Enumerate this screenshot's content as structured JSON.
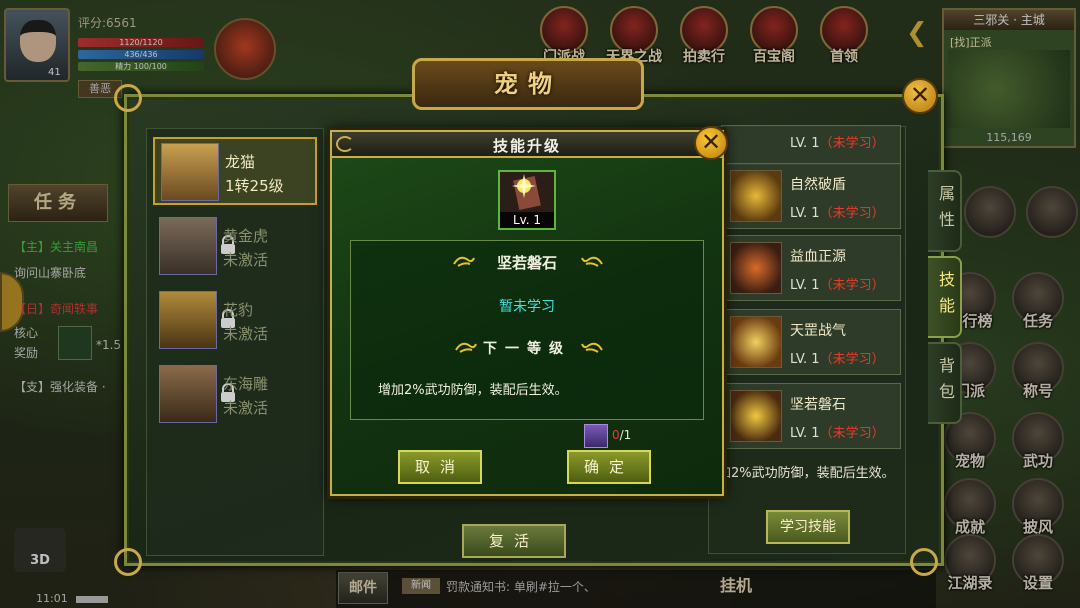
{
  "hud": {
    "score": "评分:6561",
    "hp": "1120/1120",
    "mp": "436/436",
    "stamina": "精力 100/100",
    "level": "41",
    "badge": "善恶"
  },
  "top_menu": [
    {
      "label": "门派战",
      "icon": "banner-icon"
    },
    {
      "label": "天界之战",
      "icon": "war-icon"
    },
    {
      "label": "拍卖行",
      "icon": "auction-icon"
    },
    {
      "label": "百宝阁",
      "icon": "treasure-icon"
    },
    {
      "label": "首领",
      "icon": "boss-icon"
    }
  ],
  "minimap": {
    "title": "三邪关 · 主城",
    "sub": "[找]正派",
    "coord": "115,169"
  },
  "quest": {
    "tab": "任务",
    "line1": "【主】关主南昌",
    "line2": "询问山寨卧底",
    "line3": "【日】奇闻轶事",
    "line4": "核心",
    "line5": "奖励",
    "reward_count": "*1.5",
    "line6": "【支】强化装备 ·"
  },
  "bottom": {
    "mail": "邮件",
    "news_tag": "新闻",
    "news": "罚款通知书: 单刷#拉一个、",
    "hang": "挂机",
    "mode3d": "3D",
    "time": "11:01"
  },
  "right_menu": [
    {
      "label": "排行榜",
      "icon": "ranking-icon"
    },
    {
      "label": "任务",
      "icon": "quest-icon"
    },
    {
      "label": "门派",
      "icon": "sect-icon"
    },
    {
      "label": "称号",
      "icon": "title-icon"
    },
    {
      "label": "宠物",
      "icon": "pet-icon"
    },
    {
      "label": "武功",
      "icon": "martial-icon"
    },
    {
      "label": "成就",
      "icon": "achievement-icon"
    },
    {
      "label": "披风",
      "icon": "cape-icon"
    },
    {
      "label": "江湖录",
      "icon": "journal-icon"
    },
    {
      "label": "设置",
      "icon": "settings-icon"
    }
  ],
  "pet_window": {
    "title": "宠物",
    "revive": "复活",
    "learn": "学习技能",
    "skill_desc": "加2%武功防御，装配后生效。",
    "tabs": [
      "属性",
      "技能",
      "背包"
    ],
    "pets": [
      {
        "name": "龙猫",
        "sub": "1转25级",
        "locked": false
      },
      {
        "name": "黄金虎",
        "sub": "未激活",
        "locked": true
      },
      {
        "name": "花豹",
        "sub": "未激活",
        "locked": true
      },
      {
        "name": "东海雕",
        "sub": "未激活",
        "locked": true
      }
    ],
    "skills": [
      {
        "name": "",
        "lv": "LV. 1",
        "state": "（未学习）"
      },
      {
        "name": "自然破盾",
        "lv": "LV. 1",
        "state": "（未学习）"
      },
      {
        "name": "益血正源",
        "lv": "LV. 1",
        "state": "（未学习）"
      },
      {
        "name": "天罡战气",
        "lv": "LV. 1",
        "state": "（未学习）"
      },
      {
        "name": "坚若磐石",
        "lv": "LV. 1",
        "state": "（未学习）"
      }
    ]
  },
  "dialog": {
    "title": "技能升级",
    "icon_level": "Lv. 1",
    "skill_name": "坚若磐石",
    "status": "暂未学习",
    "next_level": "下一等级",
    "description": "增加2%武功防御，装配后生效。",
    "material_current": "0",
    "material_total": "/1",
    "cancel": "取消",
    "confirm": "确定",
    "close": "✕"
  }
}
